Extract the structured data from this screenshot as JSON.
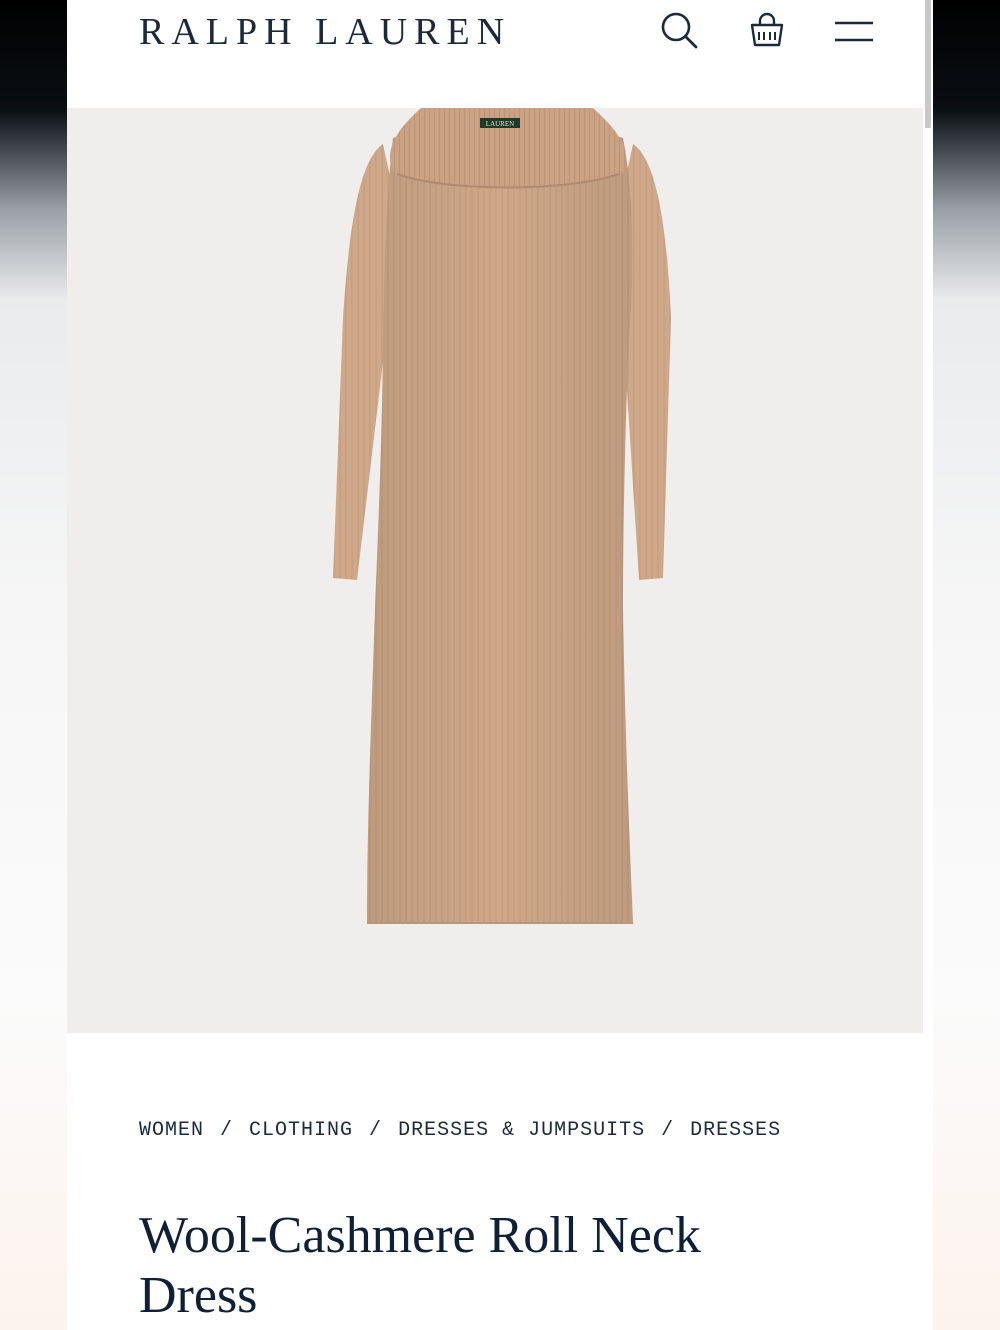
{
  "header": {
    "logo": "RALPH LAUREN",
    "icons": [
      "search-icon",
      "shopping-bag-icon",
      "hamburger-menu-icon"
    ]
  },
  "product_image": {
    "label_text": "LAUREN",
    "colors": {
      "background": "#efeeec",
      "dress": "#cfa889"
    }
  },
  "breadcrumb": {
    "items": [
      "WOMEN",
      "CLOTHING",
      "DRESSES & JUMPSUITS",
      "DRESSES"
    ],
    "separator": "/"
  },
  "product": {
    "title": "Wool-Cashmere Roll Neck Dress"
  },
  "colors": {
    "brand_navy": "#1b2a3a"
  }
}
